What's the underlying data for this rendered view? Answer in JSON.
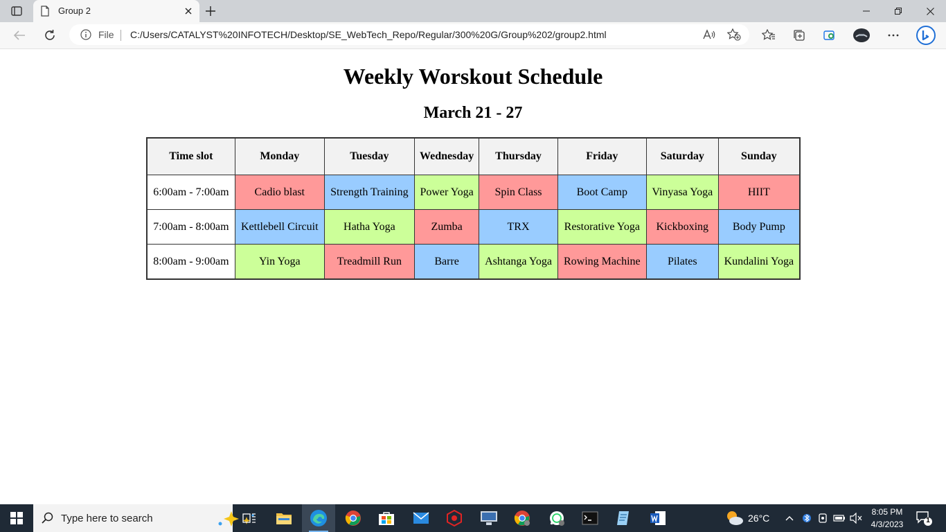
{
  "browser": {
    "tab_title": "Group 2",
    "address": {
      "file_label": "File",
      "url": "C:/Users/CATALYST%20INFOTECH/Desktop/SE_WebTech_Repo/Regular/300%20G/Group%202/group2.html"
    }
  },
  "page": {
    "title": "Weekly Worskout Schedule",
    "subtitle": "March 21 - 27",
    "columns": [
      "Time slot",
      "Monday",
      "Tuesday",
      "Wednesday",
      "Thursday",
      "Friday",
      "Saturday",
      "Sunday"
    ],
    "rows": [
      {
        "time": "6:00am - 7:00am",
        "classes": [
          {
            "name": "Cadio blast",
            "color": "#ff9999"
          },
          {
            "name": "Strength Training",
            "color": "#99ccff"
          },
          {
            "name": "Power Yoga",
            "color": "#ccff99"
          },
          {
            "name": "Spin Class",
            "color": "#ff9999"
          },
          {
            "name": "Boot Camp",
            "color": "#99ccff"
          },
          {
            "name": "Vinyasa Yoga",
            "color": "#ccff99"
          },
          {
            "name": "HIIT",
            "color": "#ff9999"
          }
        ]
      },
      {
        "time": "7:00am - 8:00am",
        "classes": [
          {
            "name": "Kettlebell Circuit",
            "color": "#99ccff"
          },
          {
            "name": "Hatha Yoga",
            "color": "#ccff99"
          },
          {
            "name": "Zumba",
            "color": "#ff9999"
          },
          {
            "name": "TRX",
            "color": "#99ccff"
          },
          {
            "name": "Restorative Yoga",
            "color": "#ccff99"
          },
          {
            "name": "Kickboxing",
            "color": "#ff9999"
          },
          {
            "name": "Body Pump",
            "color": "#99ccff"
          }
        ]
      },
      {
        "time": "8:00am - 9:00am",
        "classes": [
          {
            "name": "Yin Yoga",
            "color": "#ccff99"
          },
          {
            "name": "Treadmill Run",
            "color": "#ff9999"
          },
          {
            "name": "Barre",
            "color": "#99ccff"
          },
          {
            "name": "Ashtanga Yoga",
            "color": "#ccff99"
          },
          {
            "name": "Rowing Machine",
            "color": "#ff9999"
          },
          {
            "name": "Pilates",
            "color": "#99ccff"
          },
          {
            "name": "Kundalini Yoga",
            "color": "#ccff99"
          }
        ]
      }
    ]
  },
  "taskbar": {
    "search_placeholder": "Type here to search",
    "weather_temp": "26°C",
    "time": "8:05 PM",
    "date": "4/3/2023",
    "notification_count": "1",
    "apps": [
      "task-view",
      "file-explorer",
      "edge",
      "chrome",
      "microsoft-store",
      "mail",
      "app-red",
      "remote-desktop",
      "chrome-profile",
      "whatsapp",
      "terminal",
      "notepad",
      "word"
    ]
  }
}
